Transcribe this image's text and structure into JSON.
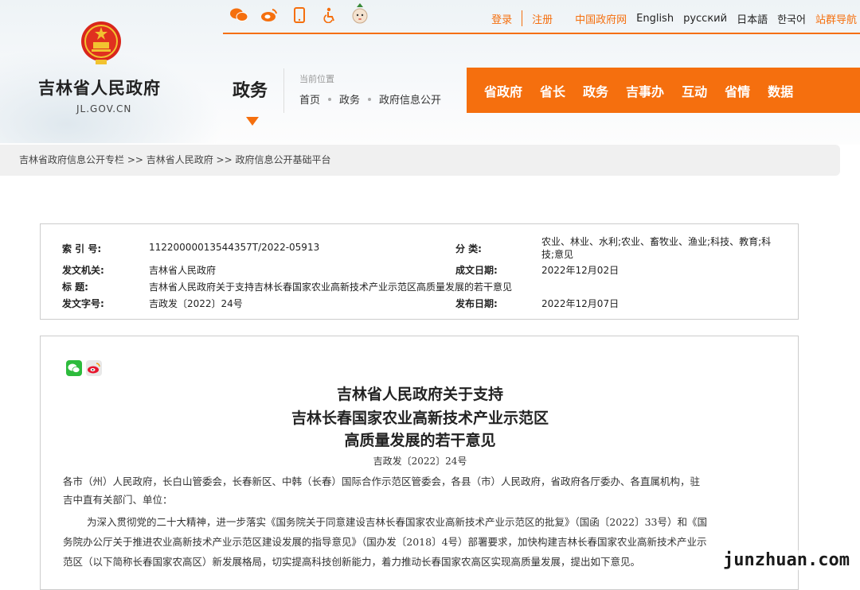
{
  "header": {
    "site_name": "吉林省人民政府",
    "site_domain": "JL.GOV.CN",
    "section_title": "政务",
    "location_label": "当前位置",
    "location": [
      "首页",
      "政务",
      "政府信息公开"
    ],
    "top_links": {
      "login": "登录",
      "register": "注册",
      "china_gov": "中国政府网",
      "english": "English",
      "russian": "русский",
      "japanese": "日本語",
      "korean": "한국어",
      "site_nav": "站群导航"
    },
    "icons": [
      "wechat-icon",
      "weibo-icon",
      "mobile-icon",
      "accessibility-icon",
      "mascot-icon"
    ],
    "nav": [
      "省政府",
      "省长",
      "政务",
      "吉事办",
      "互动",
      "省情",
      "数据"
    ],
    "accent_color": "#f56f0e"
  },
  "breadcrumb": "吉林省政府信息公开专栏 >> 吉林省人民政府 >> 政府信息公开基础平台",
  "info": {
    "index_label": "索 引 号:",
    "index_value": "11220000013544357T/2022-05913",
    "category_label": "分    类:",
    "category_value": "农业、林业、水利;农业、畜牧业、渔业;科技、教育;科技;意见",
    "issuer_label": "发文机关:",
    "issuer_value": "吉林省人民政府",
    "date_written_label": "成文日期:",
    "date_written_value": "2022年12月02日",
    "title_label": "标    题:",
    "title_value": "吉林省人民政府关于支持吉林长春国家农业高新技术产业示范区高质量发展的若干意见",
    "doc_no_label": "发文字号:",
    "doc_no_value": "吉政发〔2022〕24号",
    "publish_label": "发布日期:",
    "publish_value": "2022年12月07日"
  },
  "document": {
    "title_lines": [
      "吉林省人民政府关于支持",
      "吉林长春国家农业高新技术产业示范区",
      "高质量发展的若干意见"
    ],
    "doc_no": "吉政发〔2022〕24号",
    "para1_line1": "各市（州）人民政府，长白山管委会，长春新区、中韩（长春）国际合作示范区管委会，各县（市）人民政府，省政府各厅委办、各直属机构，驻",
    "para1_line2": "吉中直有关部门、单位：",
    "para2_line1": "为深入贯彻党的二十大精神，进一步落实《国务院关于同意建设吉林长春国家农业高新技术产业示范区的批复》（国函〔2022〕33号）和《国",
    "para2_line2": "务院办公厅关于推进农业高新技术产业示范区建设发展的指导意见》（国办发〔2018〕4号）部署要求，加快构建吉林长春国家农业高新技术产业示",
    "para2_line3": "范区（以下简称长春国家农高区）新发展格局，切实提高科技创新能力，着力推动长春国家农高区实现高质量发展，提出如下意见。"
  },
  "watermark": "junzhuan.com"
}
